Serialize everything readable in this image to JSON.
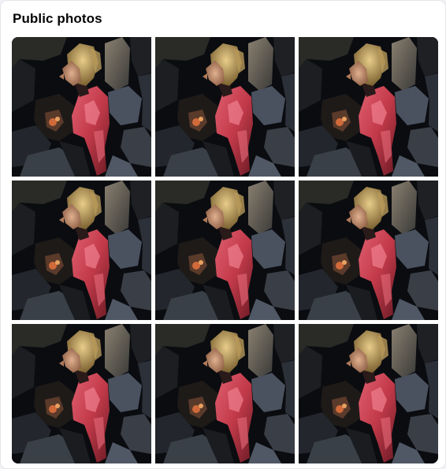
{
  "section": {
    "title": "Public photos"
  },
  "photos": [
    {
      "icon": "photo-thumbnail"
    },
    {
      "icon": "photo-thumbnail"
    },
    {
      "icon": "photo-thumbnail"
    },
    {
      "icon": "photo-thumbnail"
    },
    {
      "icon": "photo-thumbnail"
    },
    {
      "icon": "photo-thumbnail"
    },
    {
      "icon": "photo-thumbnail"
    },
    {
      "icon": "photo-thumbnail"
    },
    {
      "icon": "photo-thumbnail"
    }
  ],
  "colors": {
    "card_background": "#ffffff",
    "page_background": "#f0f2f5",
    "title_text": "#050505",
    "photo_jacket_red": "#c23a4a",
    "photo_hair_blonde": "#cdb072",
    "photo_background_dark": "#0a0c10"
  }
}
